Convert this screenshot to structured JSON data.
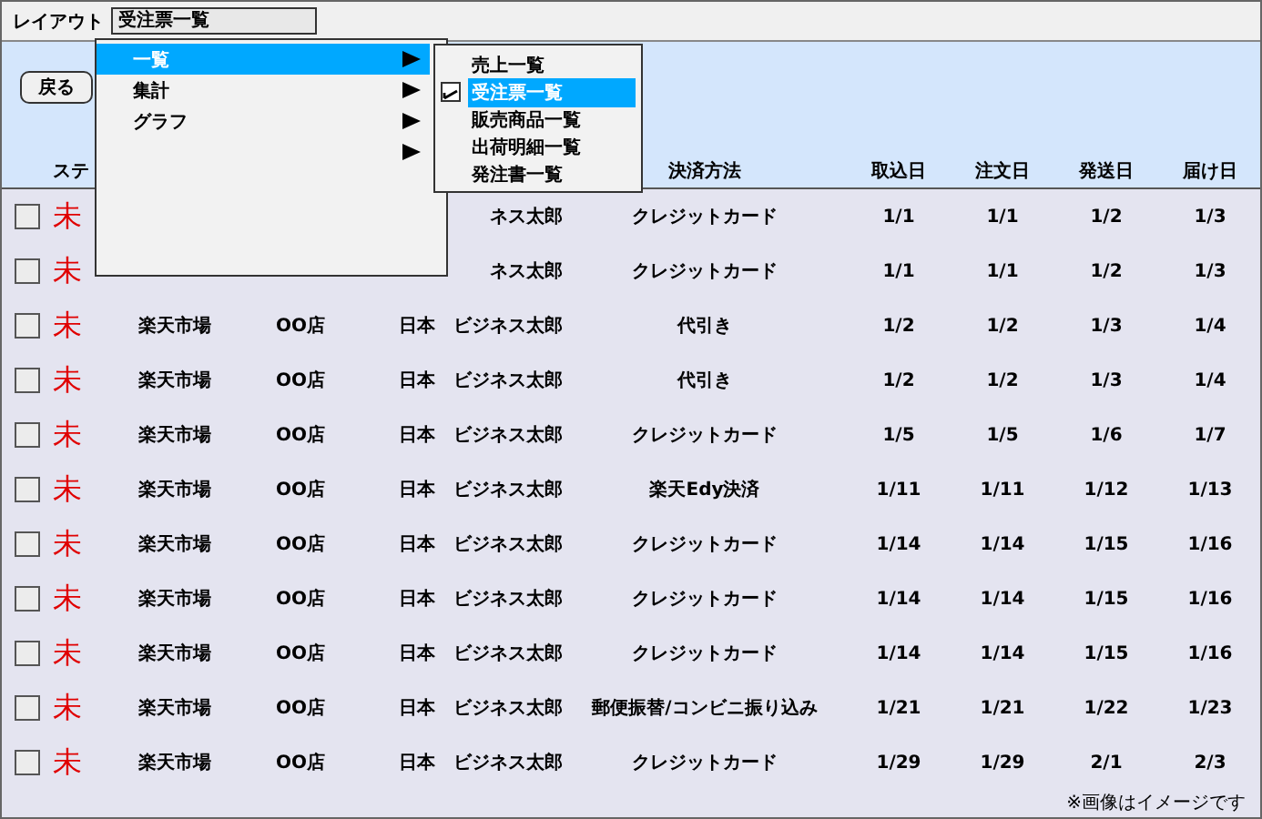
{
  "layout_bar": {
    "label": "レイアウト",
    "value": "受注票一覧"
  },
  "back_button": "戻る",
  "columns": [
    "ステ",
    "",
    "",
    "",
    "",
    "決済方法",
    "取込日",
    "注文日",
    "発送日",
    "届け日"
  ],
  "rows": [
    {
      "checked": false,
      "status": "未",
      "name": "ネス太郎",
      "payment": "クレジットカード",
      "imported": "1/1",
      "ordered": "1/1",
      "shipped": "1/2",
      "delivered": "1/3"
    },
    {
      "checked": false,
      "status": "未",
      "name": "ネス太郎",
      "payment": "クレジットカード",
      "imported": "1/1",
      "ordered": "1/1",
      "shipped": "1/2",
      "delivered": "1/3"
    },
    {
      "checked": false,
      "status": "未",
      "shop": "楽天市場",
      "store": "OO店",
      "country": "日本",
      "name": "ビジネス太郎",
      "payment": "代引き",
      "imported": "1/2",
      "ordered": "1/2",
      "shipped": "1/3",
      "delivered": "1/4"
    },
    {
      "checked": false,
      "status": "未",
      "shop": "楽天市場",
      "store": "OO店",
      "country": "日本",
      "name": "ビジネス太郎",
      "payment": "代引き",
      "imported": "1/2",
      "ordered": "1/2",
      "shipped": "1/3",
      "delivered": "1/4"
    },
    {
      "checked": false,
      "status": "未",
      "shop": "楽天市場",
      "store": "OO店",
      "country": "日本",
      "name": "ビジネス太郎",
      "payment": "クレジットカード",
      "imported": "1/5",
      "ordered": "1/5",
      "shipped": "1/6",
      "delivered": "1/7"
    },
    {
      "checked": false,
      "status": "未",
      "shop": "楽天市場",
      "store": "OO店",
      "country": "日本",
      "name": "ビジネス太郎",
      "payment": "楽天Edy決済",
      "imported": "1/11",
      "ordered": "1/11",
      "shipped": "1/12",
      "delivered": "1/13"
    },
    {
      "checked": false,
      "status": "未",
      "shop": "楽天市場",
      "store": "OO店",
      "country": "日本",
      "name": "ビジネス太郎",
      "payment": "クレジットカード",
      "imported": "1/14",
      "ordered": "1/14",
      "shipped": "1/15",
      "delivered": "1/16"
    },
    {
      "checked": false,
      "status": "未",
      "shop": "楽天市場",
      "store": "OO店",
      "country": "日本",
      "name": "ビジネス太郎",
      "payment": "クレジットカード",
      "imported": "1/14",
      "ordered": "1/14",
      "shipped": "1/15",
      "delivered": "1/16"
    },
    {
      "checked": false,
      "status": "未",
      "shop": "楽天市場",
      "store": "OO店",
      "country": "日本",
      "name": "ビジネス太郎",
      "payment": "クレジットカード",
      "imported": "1/14",
      "ordered": "1/14",
      "shipped": "1/15",
      "delivered": "1/16"
    },
    {
      "checked": false,
      "status": "未",
      "shop": "楽天市場",
      "store": "OO店",
      "country": "日本",
      "name": "ビジネス太郎",
      "payment": "郵便振替/コンビニ振り込み",
      "imported": "1/21",
      "ordered": "1/21",
      "shipped": "1/22",
      "delivered": "1/23"
    },
    {
      "checked": false,
      "status": "未",
      "shop": "楽天市場",
      "store": "OO店",
      "country": "日本",
      "name": "ビジネス太郎",
      "payment": "クレジットカード",
      "imported": "1/29",
      "ordered": "1/29",
      "shipped": "2/1",
      "delivered": "2/3"
    }
  ],
  "footnote": "※画像はイメージです",
  "menu": {
    "items": [
      {
        "label": "一覧",
        "selected": true
      },
      {
        "label": "集計",
        "selected": false
      },
      {
        "label": "グラフ",
        "selected": false
      },
      {
        "selected": false
      }
    ]
  },
  "submenu": {
    "items": [
      {
        "label": "売上一覧",
        "selected": false
      },
      {
        "label": "受注票一覧",
        "selected": true
      },
      {
        "label": "販売商品一覧",
        "selected": false
      },
      {
        "label": "出荷明細一覧",
        "selected": false
      },
      {
        "label": "発注書一覧",
        "selected": false
      }
    ]
  }
}
